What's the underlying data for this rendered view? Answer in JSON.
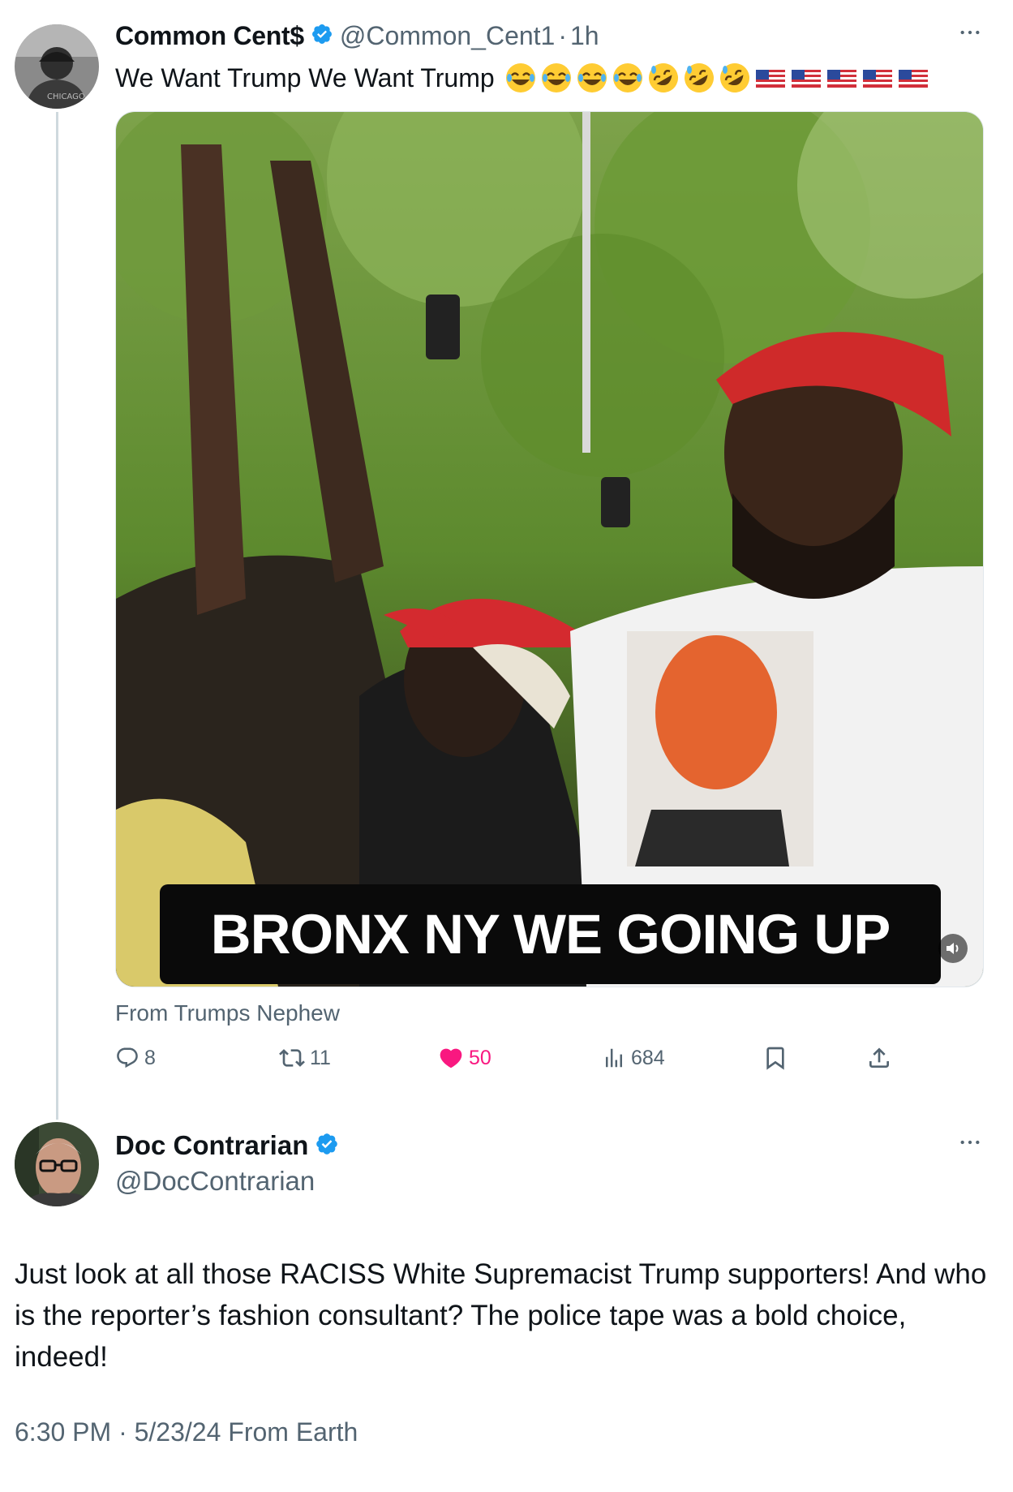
{
  "tweet": {
    "author_name": "Common Cent$",
    "handle": "@Common_Cent1",
    "separator": "·",
    "time_ago": "1h",
    "text": "We Want Trump We Want Trump",
    "emojis": [
      "joy",
      "joy",
      "joy",
      "joy",
      "rofl",
      "rofl",
      "rofl",
      "us-flag",
      "us-flag",
      "us-flag",
      "us-flag",
      "us-flag"
    ],
    "video_caption": "BRONX NY WE GOING UP",
    "from_label": "From Trumps Nephew",
    "stats": {
      "replies": "8",
      "reposts": "11",
      "likes": "50",
      "views": "684"
    },
    "colors": {
      "like": "#f91880",
      "verified": "#1d9bf0",
      "muted": "#536471"
    }
  },
  "reply": {
    "author_name": "Doc Contrarian",
    "handle": "@DocContrarian",
    "text": "Just look at all those RACISS White Supremacist Trump supporters! And who is the reporter’s fashion consultant? The police tape was a bold choice, indeed!",
    "timestamp": "6:30 PM · 5/23/24 From Earth"
  },
  "icons": {
    "more": "more-horizontal-icon",
    "reply": "reply-icon",
    "repost": "repost-icon",
    "like": "heart-icon",
    "views": "views-icon",
    "bookmark": "bookmark-icon",
    "share": "share-icon",
    "mute": "volume-icon",
    "verified": "verified-badge-icon"
  }
}
